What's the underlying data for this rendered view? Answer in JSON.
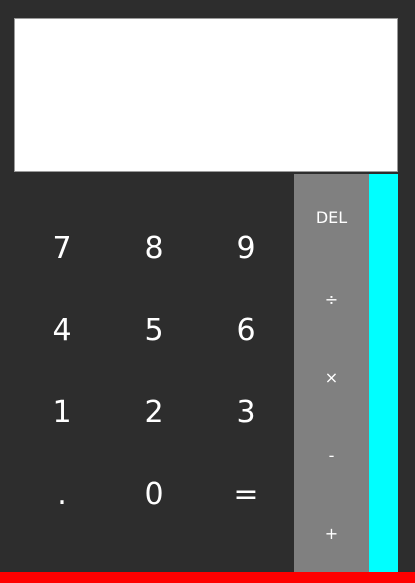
{
  "display": {
    "value": ""
  },
  "keys": {
    "k7": "7",
    "k8": "8",
    "k9": "9",
    "k4": "4",
    "k5": "5",
    "k6": "6",
    "k1": "1",
    "k2": "2",
    "k3": "3",
    "dot": ".",
    "k0": "0",
    "eq": "="
  },
  "ops": {
    "del": "DEL",
    "divide": "÷",
    "multiply": "×",
    "minus": "-",
    "plus": "+"
  },
  "colors": {
    "background": "#2d2d2d",
    "display": "#ffffff",
    "ops_panel": "#808080",
    "accent": "#00ffff",
    "bottom_bar": "#ff0000"
  }
}
